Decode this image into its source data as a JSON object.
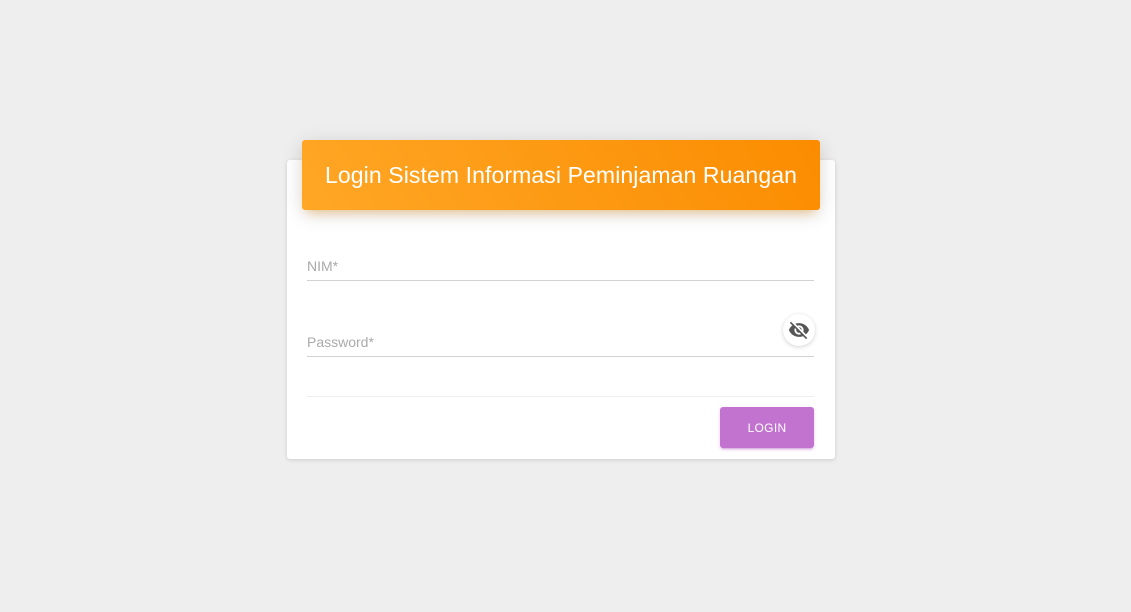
{
  "card": {
    "title": "Login Sistem Informasi Peminjaman Ruangan"
  },
  "form": {
    "nim": {
      "label": "NIM*",
      "value": ""
    },
    "password": {
      "label": "Password*",
      "value": "",
      "toggle_icon": "eye-off-icon"
    },
    "submit_label": "LOGIN"
  },
  "colors": {
    "background": "#eeeeee",
    "header_gradient_start": "#ffa726",
    "header_gradient_end": "#fb8c00",
    "button": "#c273d0"
  }
}
